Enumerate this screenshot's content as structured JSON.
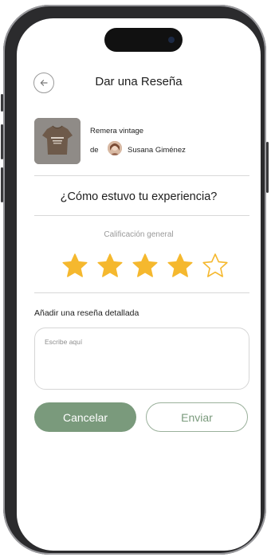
{
  "header": {
    "title": "Dar una Reseña"
  },
  "product": {
    "name": "Remera vintage",
    "by_label": "de",
    "seller": "Susana Giménez"
  },
  "question": "¿Cómo estuvo tu experiencia?",
  "rating": {
    "label": "Calificación general",
    "value": 4,
    "max": 5,
    "color": "#f5b82e"
  },
  "review": {
    "label": "Añadir una reseña detallada",
    "placeholder": "Escribe aquí"
  },
  "actions": {
    "cancel": "Cancelar",
    "submit": "Enviar"
  },
  "colors": {
    "accent": "#7a9a7c"
  }
}
